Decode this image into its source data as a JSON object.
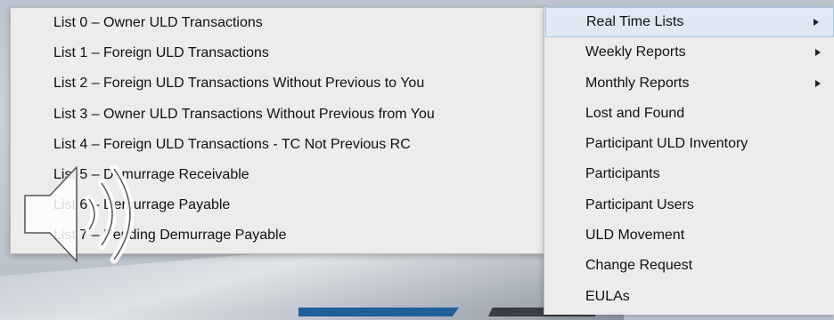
{
  "submenu": {
    "items": [
      "List 0 – Owner ULD Transactions",
      "List 1 – Foreign ULD Transactions",
      "List 2 – Foreign ULD Transactions Without Previous to You",
      "List 3 – Owner ULD Transactions Without Previous from You",
      "List 4 – Foreign ULD Transactions - TC Not Previous RC",
      "List 5 – Demurrage Receivable",
      "List 6 – Demurrage Payable",
      "List 7 – Pending Demurrage Payable"
    ]
  },
  "menu": {
    "items": [
      {
        "label": "Real Time Lists",
        "has_submenu": true,
        "highlighted": true
      },
      {
        "label": "Weekly Reports",
        "has_submenu": true
      },
      {
        "label": "Monthly Reports",
        "has_submenu": true
      },
      {
        "label": "Lost and Found",
        "has_submenu": false
      },
      {
        "label": "Participant ULD Inventory",
        "has_submenu": false
      },
      {
        "label": "Participants",
        "has_submenu": false
      },
      {
        "label": "Participant Users",
        "has_submenu": false
      },
      {
        "label": "ULD Movement",
        "has_submenu": false
      },
      {
        "label": "Change Request",
        "has_submenu": false
      },
      {
        "label": "EULAs",
        "has_submenu": false
      }
    ]
  },
  "overlay": {
    "icon": "speaker-volume-icon"
  },
  "colors": {
    "menu_bg": "#ececec",
    "highlight_bg": "#dfe9f4",
    "highlight_border": "#a9c4e0"
  }
}
